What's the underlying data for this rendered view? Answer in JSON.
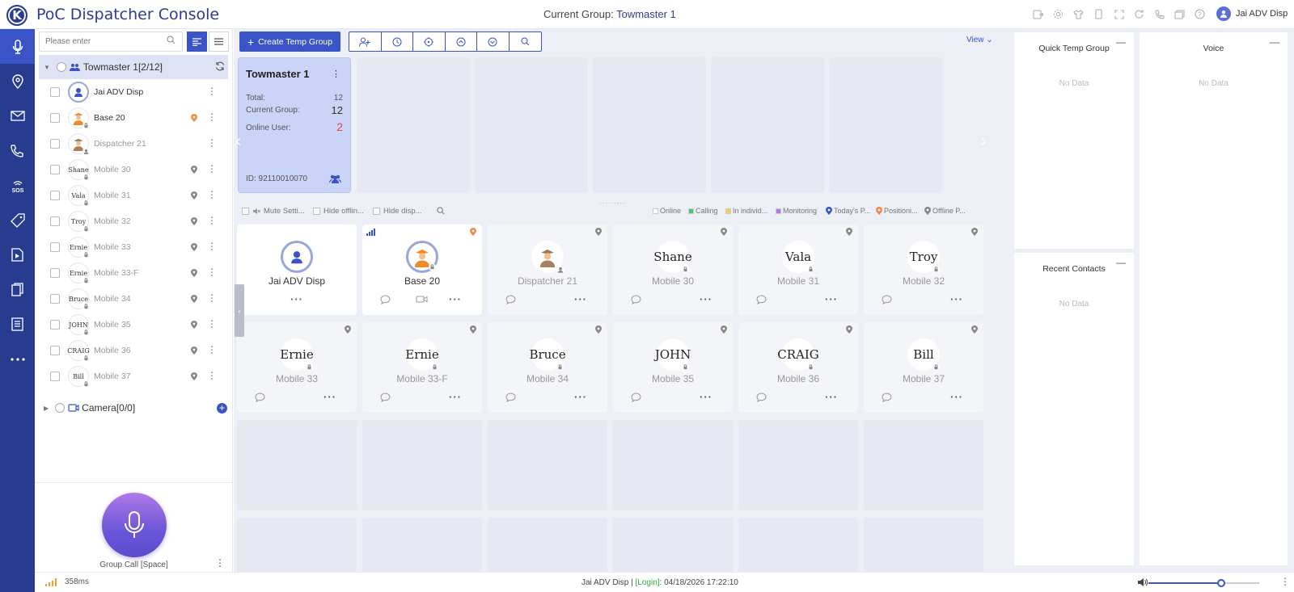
{
  "app": {
    "title": "PoC Dispatcher Console",
    "current_group_label": "Current Group:",
    "current_group_name": "Towmaster 1",
    "user": "Jai ADV Disp"
  },
  "nav": [
    "mic-icon",
    "location-icon",
    "mail-icon",
    "phone-icon",
    "sos-icon",
    "tag-icon",
    "media-icon",
    "document-icon",
    "report-icon",
    "more-icon"
  ],
  "sidebar": {
    "search_placeholder": "Please enter",
    "group": {
      "name": "Towmaster 1[2/12]"
    },
    "members": [
      {
        "name": "Jai ADV Disp",
        "avatar": "",
        "online": true,
        "type": "disp",
        "pin": false
      },
      {
        "name": "Base 20",
        "avatar": "",
        "online": true,
        "type": "base",
        "pin": true
      },
      {
        "name": "Dispatcher 21",
        "avatar": "",
        "online": false,
        "type": "officer",
        "pin": false
      },
      {
        "name": "Mobile 30",
        "avatar": "Shane",
        "online": false,
        "type": "text",
        "pin": true
      },
      {
        "name": "Mobile 31",
        "avatar": "Vala",
        "online": false,
        "type": "text",
        "pin": true
      },
      {
        "name": "Mobile 32",
        "avatar": "Troy",
        "online": false,
        "type": "text",
        "pin": true
      },
      {
        "name": "Mobile 33",
        "avatar": "Ernie",
        "online": false,
        "type": "text",
        "pin": true
      },
      {
        "name": "Mobile 33-F",
        "avatar": "Ernie",
        "online": false,
        "type": "text",
        "pin": true
      },
      {
        "name": "Mobile 34",
        "avatar": "Bruce",
        "online": false,
        "type": "text",
        "pin": true
      },
      {
        "name": "Mobile 35",
        "avatar": "JOHN",
        "online": false,
        "type": "text",
        "pin": true
      },
      {
        "name": "Mobile 36",
        "avatar": "CRAIG",
        "online": false,
        "type": "text",
        "pin": true
      },
      {
        "name": "Mobile 37",
        "avatar": "Bill",
        "online": false,
        "type": "text",
        "pin": true
      }
    ],
    "camera": "Camera[0/0]",
    "group_call_label": "Group Call [Space]"
  },
  "toolbar": {
    "create_label": "Create Temp Group",
    "view_label": "View"
  },
  "group_card": {
    "title": "Towmaster 1",
    "total_label": "Total:",
    "total": "12",
    "current_label": "Current Group:",
    "current": "12",
    "online_label": "Online User:",
    "online": "2",
    "id": "ID: 92110010070"
  },
  "filters": {
    "mute": "Mute Setti...",
    "hide_offline": "Hide offlin...",
    "hide_disp": "Hide disp..."
  },
  "legend": [
    {
      "label": "Online",
      "color": "#ffffff"
    },
    {
      "label": "Calling",
      "color": "#3fcf7a"
    },
    {
      "label": "In individ...",
      "color": "#f3d04a"
    },
    {
      "label": "Monitoring",
      "color": "#b57ad8"
    },
    {
      "label": "Today's P...",
      "color": "#3a54c7"
    },
    {
      "label": "Positioni...",
      "color": "#f0894a"
    },
    {
      "label": "Offline P...",
      "color": "#888888"
    }
  ],
  "panels": {
    "quick_temp": "Quick Temp Group",
    "recent": "Recent Contacts",
    "voice": "Voice",
    "no_data": "No Data"
  },
  "status": {
    "ping": "358ms",
    "user": "Jai ADV Disp |",
    "login": "[Login]",
    "time": ": 04/18/2026 17:22:10",
    "volume_fraction": 0.66
  }
}
